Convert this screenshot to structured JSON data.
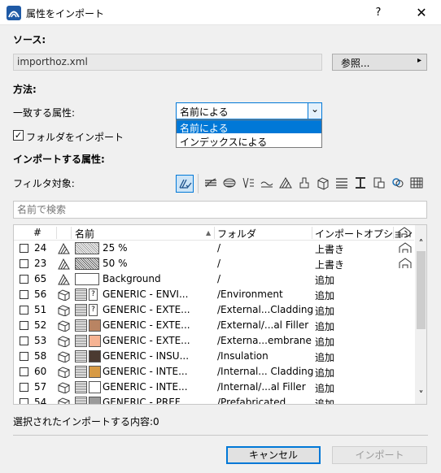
{
  "window": {
    "title": "属性をインポート",
    "help_label": "?",
    "close_label": "✕"
  },
  "source": {
    "label": "ソース:",
    "file_value": "importhoz.xml",
    "browse_label": "参照...",
    "browse_arrow": "▸"
  },
  "method": {
    "label": "方法:",
    "match_label": "一致する属性:",
    "selected": "名前による",
    "arrow": "⌄",
    "options": [
      "名前による",
      "インデックスによる"
    ]
  },
  "folders": {
    "checkbox_label": "フォルダをインポート",
    "checked": true,
    "check_glyph": "✓"
  },
  "import_attrs": {
    "label": "インポートする属性:",
    "filter_label": "フィルタ対象:"
  },
  "search": {
    "placeholder": "名前で検索"
  },
  "table": {
    "headers": {
      "num": "#",
      "name": "名前",
      "sort_arrow": "▲",
      "folder": "フォルダ",
      "option": "インポートオプション"
    },
    "rows": [
      {
        "num": "24",
        "name": "25 %",
        "folder": "/",
        "option": "上書き",
        "kind": "fill",
        "color": "#ffffff",
        "pattern": "dots-fine"
      },
      {
        "num": "23",
        "name": "50 %",
        "folder": "/",
        "option": "上書き",
        "kind": "fill",
        "color": "#ffffff",
        "pattern": "dots"
      },
      {
        "num": "65",
        "name": "Background",
        "folder": "/",
        "option": "追加",
        "kind": "fill",
        "color": "#ffffff",
        "pattern": "none"
      },
      {
        "num": "56",
        "name": "GENERIC - ENVI...",
        "folder": "/Environment",
        "option": "追加",
        "kind": "building",
        "color": "#ffffff",
        "pattern": "q"
      },
      {
        "num": "51",
        "name": "GENERIC - EXTE...",
        "folder": "/External...Cladding",
        "option": "追加",
        "kind": "building",
        "color": "#ffffff",
        "pattern": "q"
      },
      {
        "num": "52",
        "name": "GENERIC - EXTE...",
        "folder": "/External/...al Filler",
        "option": "追加",
        "kind": "building",
        "color": "#b98463",
        "pattern": "solid"
      },
      {
        "num": "53",
        "name": "GENERIC - EXTE...",
        "folder": "/Externa...embrane",
        "option": "追加",
        "kind": "building",
        "color": "#f6b393",
        "pattern": "solid"
      },
      {
        "num": "58",
        "name": "GENERIC - INSU...",
        "folder": "/Insulation",
        "option": "追加",
        "kind": "building",
        "color": "#4b3a31",
        "pattern": "solid"
      },
      {
        "num": "60",
        "name": "GENERIC - INTE...",
        "folder": "/Internal... Cladding",
        "option": "追加",
        "kind": "building",
        "color": "#d79a44",
        "pattern": "solid"
      },
      {
        "num": "57",
        "name": "GENERIC - INTE...",
        "folder": "/Internal/...al Filler",
        "option": "追加",
        "kind": "building",
        "color": "#ffffff",
        "pattern": "solid"
      },
      {
        "num": "54",
        "name": "GENERIC - PREF...",
        "folder": "/Prefabricated",
        "option": "追加",
        "kind": "building",
        "color": "#9a9a9a",
        "pattern": "solid"
      }
    ]
  },
  "status": {
    "selected_text": "選択されたインポートする内容:0"
  },
  "buttons": {
    "cancel": "キャンセル",
    "import": "インポート"
  },
  "scroll": {
    "up": "˄",
    "down": "˅"
  },
  "colors": {
    "accent": "#0078d7",
    "selection": "#0078d7"
  }
}
